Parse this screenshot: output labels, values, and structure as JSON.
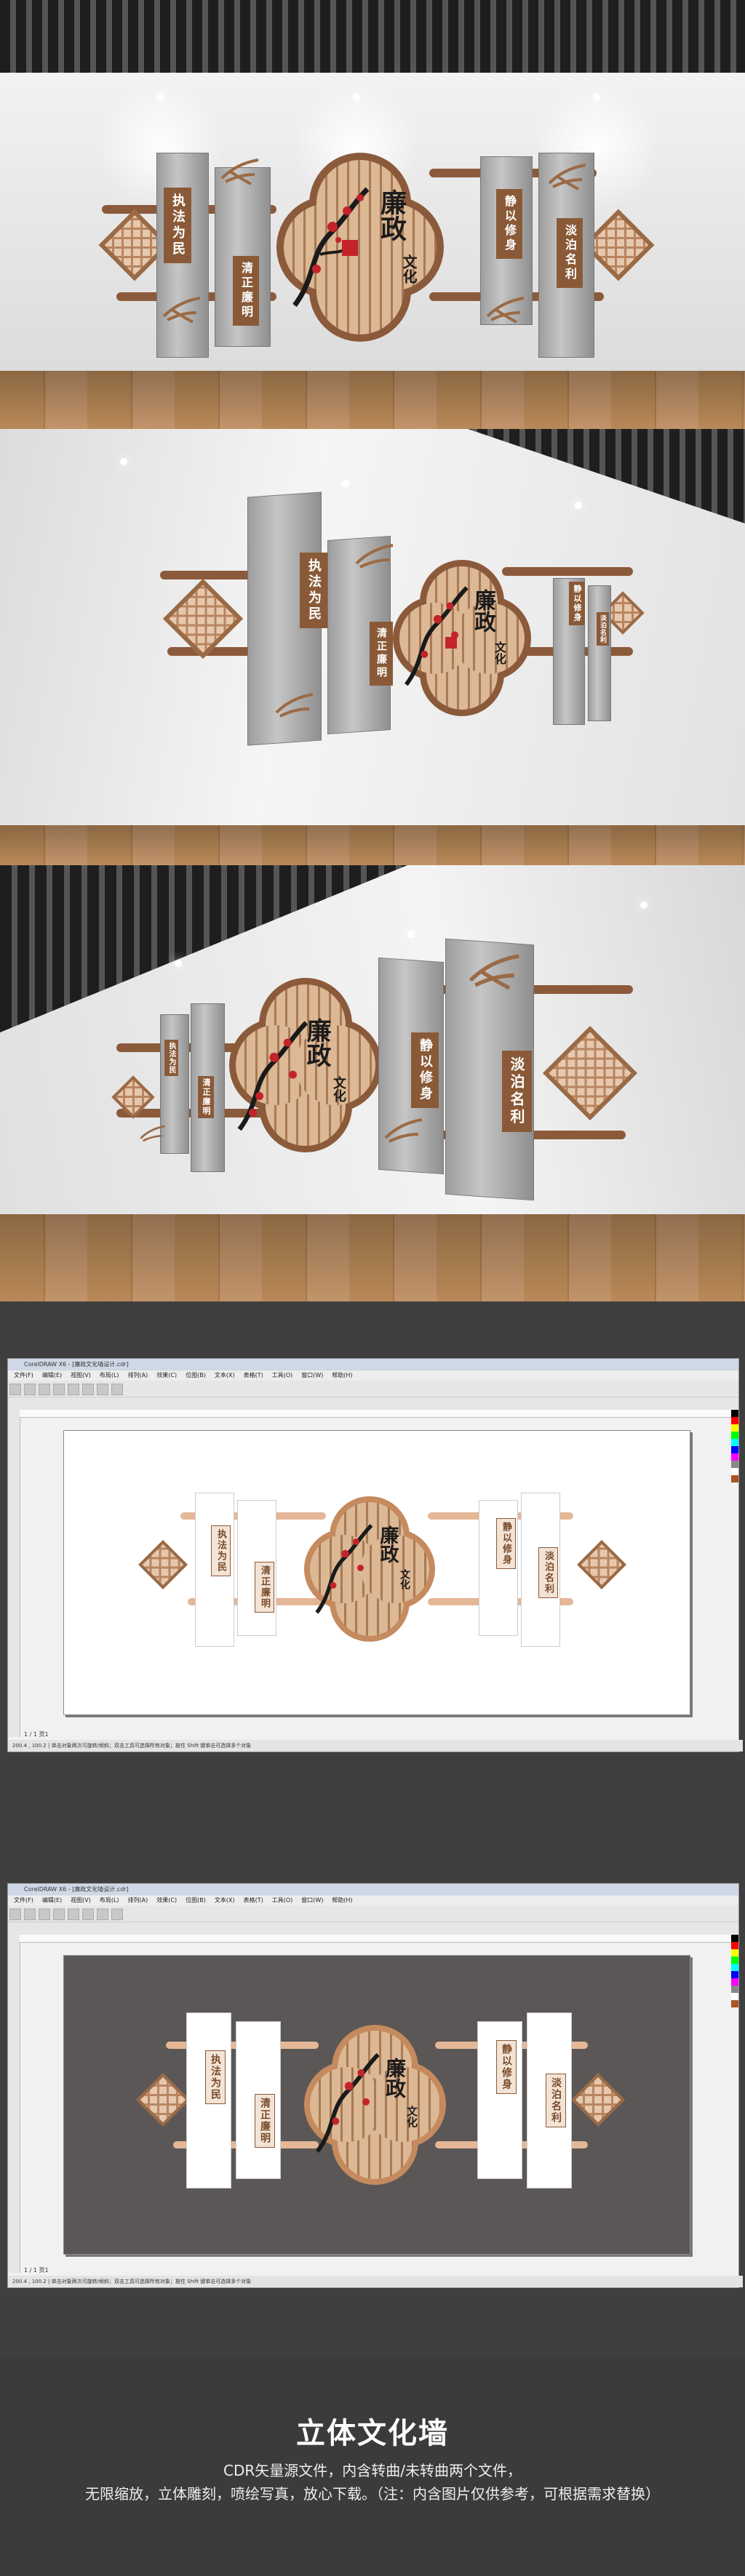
{
  "scenes": {
    "titles": {
      "main": "廉政文化",
      "main_line1": "廉政",
      "main_line2": "文化",
      "left_panel_1": "执法为民",
      "left_panel_2": "清正廉明",
      "right_panel_1": "静以修身",
      "right_panel_2": "淡泊名利"
    }
  },
  "software": {
    "app_title": "CorelDRAW X6 - [廉政文化墙设计.cdr]",
    "menu": [
      "文件(F)",
      "编辑(E)",
      "视图(V)",
      "布局(L)",
      "排列(A)",
      "效果(C)",
      "位图(B)",
      "文本(X)",
      "表格(T)",
      "工具(O)",
      "窗口(W)",
      "帮助(H)"
    ],
    "status_text": "200.4 , 100.2 | 单击对象两次可旋转/倾斜；双击工具可选择所有对象；按住 Shift 键单击可选择多个对象",
    "page_indicator": "1 / 1  页1"
  },
  "footer": {
    "title": "立体文化墙",
    "line1": "CDR矢量源文件，内含转曲/未转曲两个文件，",
    "line2": "无限缩放，立体雕刻，喷绘写真，放心下载。（注：内含图片仅供参考，可根据需求替换）"
  },
  "colors": {
    "brown_dark": "#8b5a3b",
    "brown_light": "#e4b797",
    "plum_red": "#c3242a",
    "dark_bg": "#3b3b3b"
  }
}
